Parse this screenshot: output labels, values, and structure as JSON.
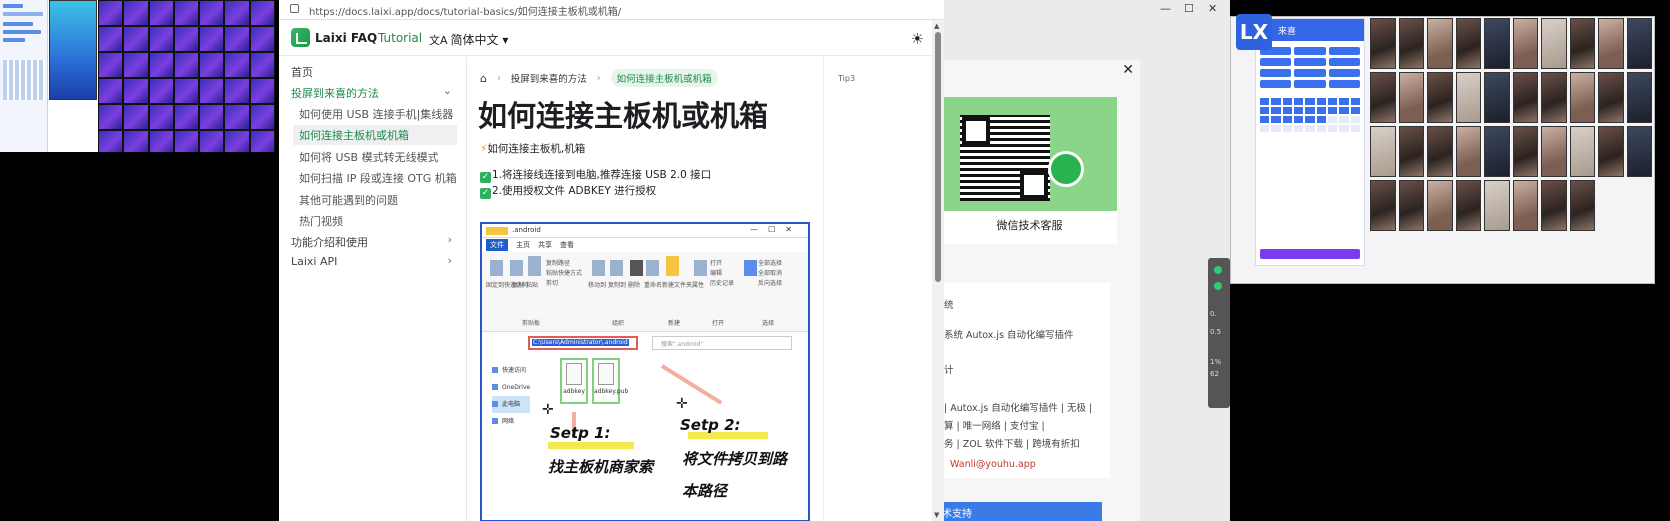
{
  "browser": {
    "url": "https://docs.laixi.app/docs/tutorial-basics/如何连接主板机或机箱/",
    "logo_title": "Laixi FAQ",
    "nav_tutorial": "Tutorial",
    "nav_language": "简体中文"
  },
  "sidebar": {
    "items": [
      {
        "label": "首页"
      },
      {
        "label": "投屏到来喜的方法"
      },
      {
        "label": "如何使用 USB 连接手机|集线器"
      },
      {
        "label": "如何连接主板机或机箱"
      },
      {
        "label": "如何将 USB 模式转无线模式"
      },
      {
        "label": "如何扫描 IP 段或连接 OTG 机箱"
      },
      {
        "label": "其他可能遇到的问题"
      },
      {
        "label": "热门视频"
      },
      {
        "label": "功能介绍和使用"
      },
      {
        "label": "Laixi API"
      }
    ]
  },
  "breadcrumb": {
    "section": "投屏到来喜的方法",
    "current": "如何连接主板机或机箱"
  },
  "article": {
    "title": "如何连接主板机或机箱",
    "intro": "如何连接主板机,机箱",
    "step1": "1.将连接线连接到电脑,推荐连接 USB 2.0 接口",
    "step2": "2.使用授权文件 ADBKEY 进行授权"
  },
  "toc": {
    "label": "Tip3"
  },
  "screenshot": {
    "file_tab": "文件",
    "tabs": [
      "主页",
      "共享",
      "查看"
    ],
    "title": ".android",
    "address": "C:\\Users\\Administrator\\.android",
    "search_placeholder": "搜索\".android\"",
    "tree": [
      "快速访问",
      "OneDrive",
      "此电脑",
      "网络"
    ],
    "file1": "adbkey",
    "file2": "adbkey.pub",
    "step1_label": "Setp 1:",
    "step1_text": "找主板机商家索",
    "step2_label": "Setp 2:",
    "step2_text": "将文件拷贝到路",
    "step2_text2": "本路径",
    "ribbon_groups": [
      "剪贴板",
      "组织",
      "新建",
      "打开",
      "选择"
    ],
    "ribbon_labels": {
      "pin": "固定到快速访问",
      "copy": "复制",
      "paste": "粘贴",
      "copy_path": "复制路径",
      "paste_shortcut": "粘贴快捷方式",
      "cut": "剪切",
      "move_to": "移动到",
      "copy_to": "复制到",
      "delete": "删除",
      "rename": "重命名",
      "new_folder": "新建文件夹",
      "properties": "属性",
      "open": "打开",
      "edit": "编辑",
      "history": "历史记录",
      "select_all": "全部选择",
      "select_none": "全部取消",
      "invert": "反向选择"
    }
  },
  "dialog": {
    "qr_caption": "微信技术客服",
    "lines": [
      "统",
      "系统    Autox.js 自动化编写插件",
      "计",
      "|  Autox.js 自动化编写插件  |  无极  |",
      "算  |  唯一网络  |  支付宝  |",
      "务  |  ZOL 软件下载  |  跨境有折扣",
      "Wanli@youhu.app"
    ],
    "button": "术支持"
  },
  "laixi_app": {
    "logo": "LX",
    "title": "来喜"
  },
  "colors": {
    "accent": "#1f8a4c",
    "brand_blue": "#3566e8",
    "purple": "#7b3cf0",
    "warning": "#f39c12"
  }
}
